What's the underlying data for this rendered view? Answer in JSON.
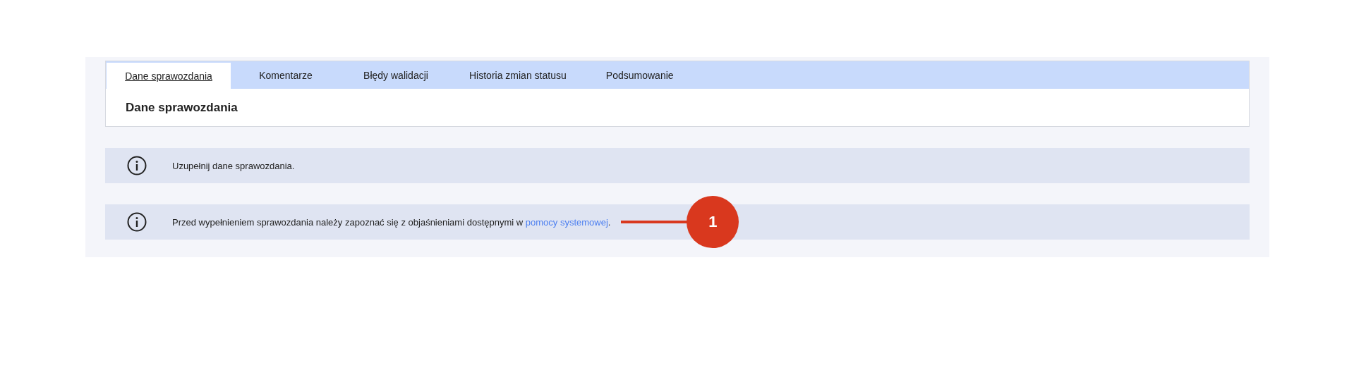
{
  "tabs": [
    {
      "label": "Dane sprawozdania",
      "selected": true
    },
    {
      "label": "Komentarze",
      "selected": false
    },
    {
      "label": "Błędy walidacji",
      "selected": false
    },
    {
      "label": "Historia zmian statusu",
      "selected": false
    },
    {
      "label": "Podsumowanie",
      "selected": false
    }
  ],
  "section_title": "Dane sprawozdania",
  "messages": [
    {
      "text": "Uzupełnij dane sprawozdania."
    },
    {
      "text": "Przed wypełnieniem sprawozdania należy zapoznać się z objaśnieniami dostępnymi w ",
      "link": "pomocy systemowej",
      "text_after": "."
    }
  ],
  "callout": {
    "label": "1"
  }
}
